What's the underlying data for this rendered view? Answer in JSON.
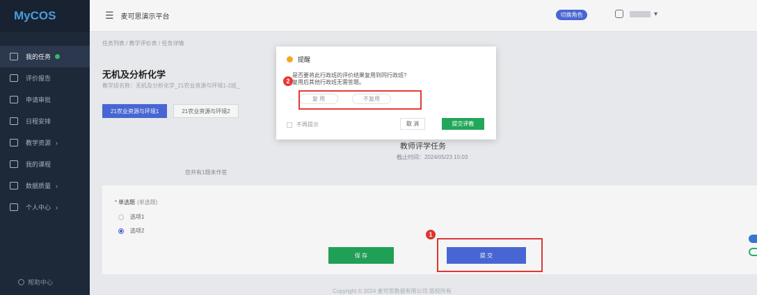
{
  "app": {
    "logo": "MyCOS"
  },
  "header": {
    "menu_icon": "hamburger-icon",
    "platform": "麦可思演示平台",
    "tag": "切换角色"
  },
  "sidebar": {
    "items": [
      {
        "label": "我的任务",
        "icon": "task-icon"
      },
      {
        "label": "评价报告",
        "icon": "report-icon"
      },
      {
        "label": "申请审批",
        "icon": "approve-icon"
      },
      {
        "label": "日程安排",
        "icon": "calendar-icon"
      },
      {
        "label": "教学资源",
        "icon": "resource-icon"
      },
      {
        "label": "我的课程",
        "icon": "course-icon"
      },
      {
        "label": "数据质量",
        "icon": "data-icon"
      },
      {
        "label": "个人中心",
        "icon": "user-icon"
      }
    ],
    "help": "帮助中心"
  },
  "breadcrumb": "任务列表 / 教学评价表 / 任务详情",
  "course": {
    "title": "无机及分析化学",
    "meta": "教学班名称：无机及分析化学_21农业资源与环境1-2班_"
  },
  "tabs": [
    "21农业资源与环境1",
    "21农业资源与环境2"
  ],
  "task": {
    "title": "教师评学任务",
    "end_time": "截止时间：2024/05/23 15:03",
    "unanswered": "您共有1题未作答"
  },
  "question": {
    "required_mark": "*",
    "title": "单选题",
    "type": "(单选题)",
    "options": [
      "选项1",
      "选项2"
    ],
    "selected": 1
  },
  "buttons": {
    "save": "保 存",
    "submit": "提 交"
  },
  "footer": "Copyright © 2024 麦可思数据有限公司 版权所有",
  "dialog": {
    "title": "提醒",
    "body_line1": "是否要将此行政班的评价结果复用到同行政班?",
    "body_line2": "复用后其他行政班无需答题。",
    "choice_yes": "复 用",
    "choice_no": "不复用",
    "checkbox": "不再提示",
    "cancel": "取 消",
    "ok": "提交评教"
  },
  "badges": {
    "first": "1",
    "second": "2"
  },
  "colors": {
    "primary": "#4b6bdc",
    "success": "#22a65a",
    "highlight": "#e53935",
    "sidebar": "#1f2a3c"
  }
}
